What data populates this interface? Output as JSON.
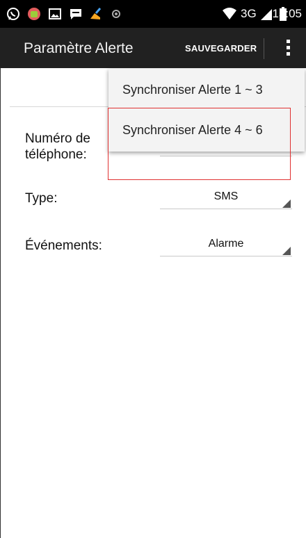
{
  "status_bar": {
    "time": "15:05",
    "network": "3G"
  },
  "app_bar": {
    "title": "Paramètre Alerte",
    "save_label": "SAUVEGARDER"
  },
  "form": {
    "phone_label": "Numéro de téléphone:",
    "phone_value": "",
    "type_label": "Type:",
    "type_value": "SMS",
    "events_label": "Événements:",
    "events_value": "Alarme"
  },
  "menu": {
    "items": [
      {
        "label": "Synchroniser Alerte 1 ~ 3"
      },
      {
        "label": "Synchroniser Alerte 4 ~ 6"
      }
    ]
  },
  "colors": {
    "status_bar_bg": "#000000",
    "app_bar_bg": "#212121",
    "highlight": "#e03030"
  }
}
